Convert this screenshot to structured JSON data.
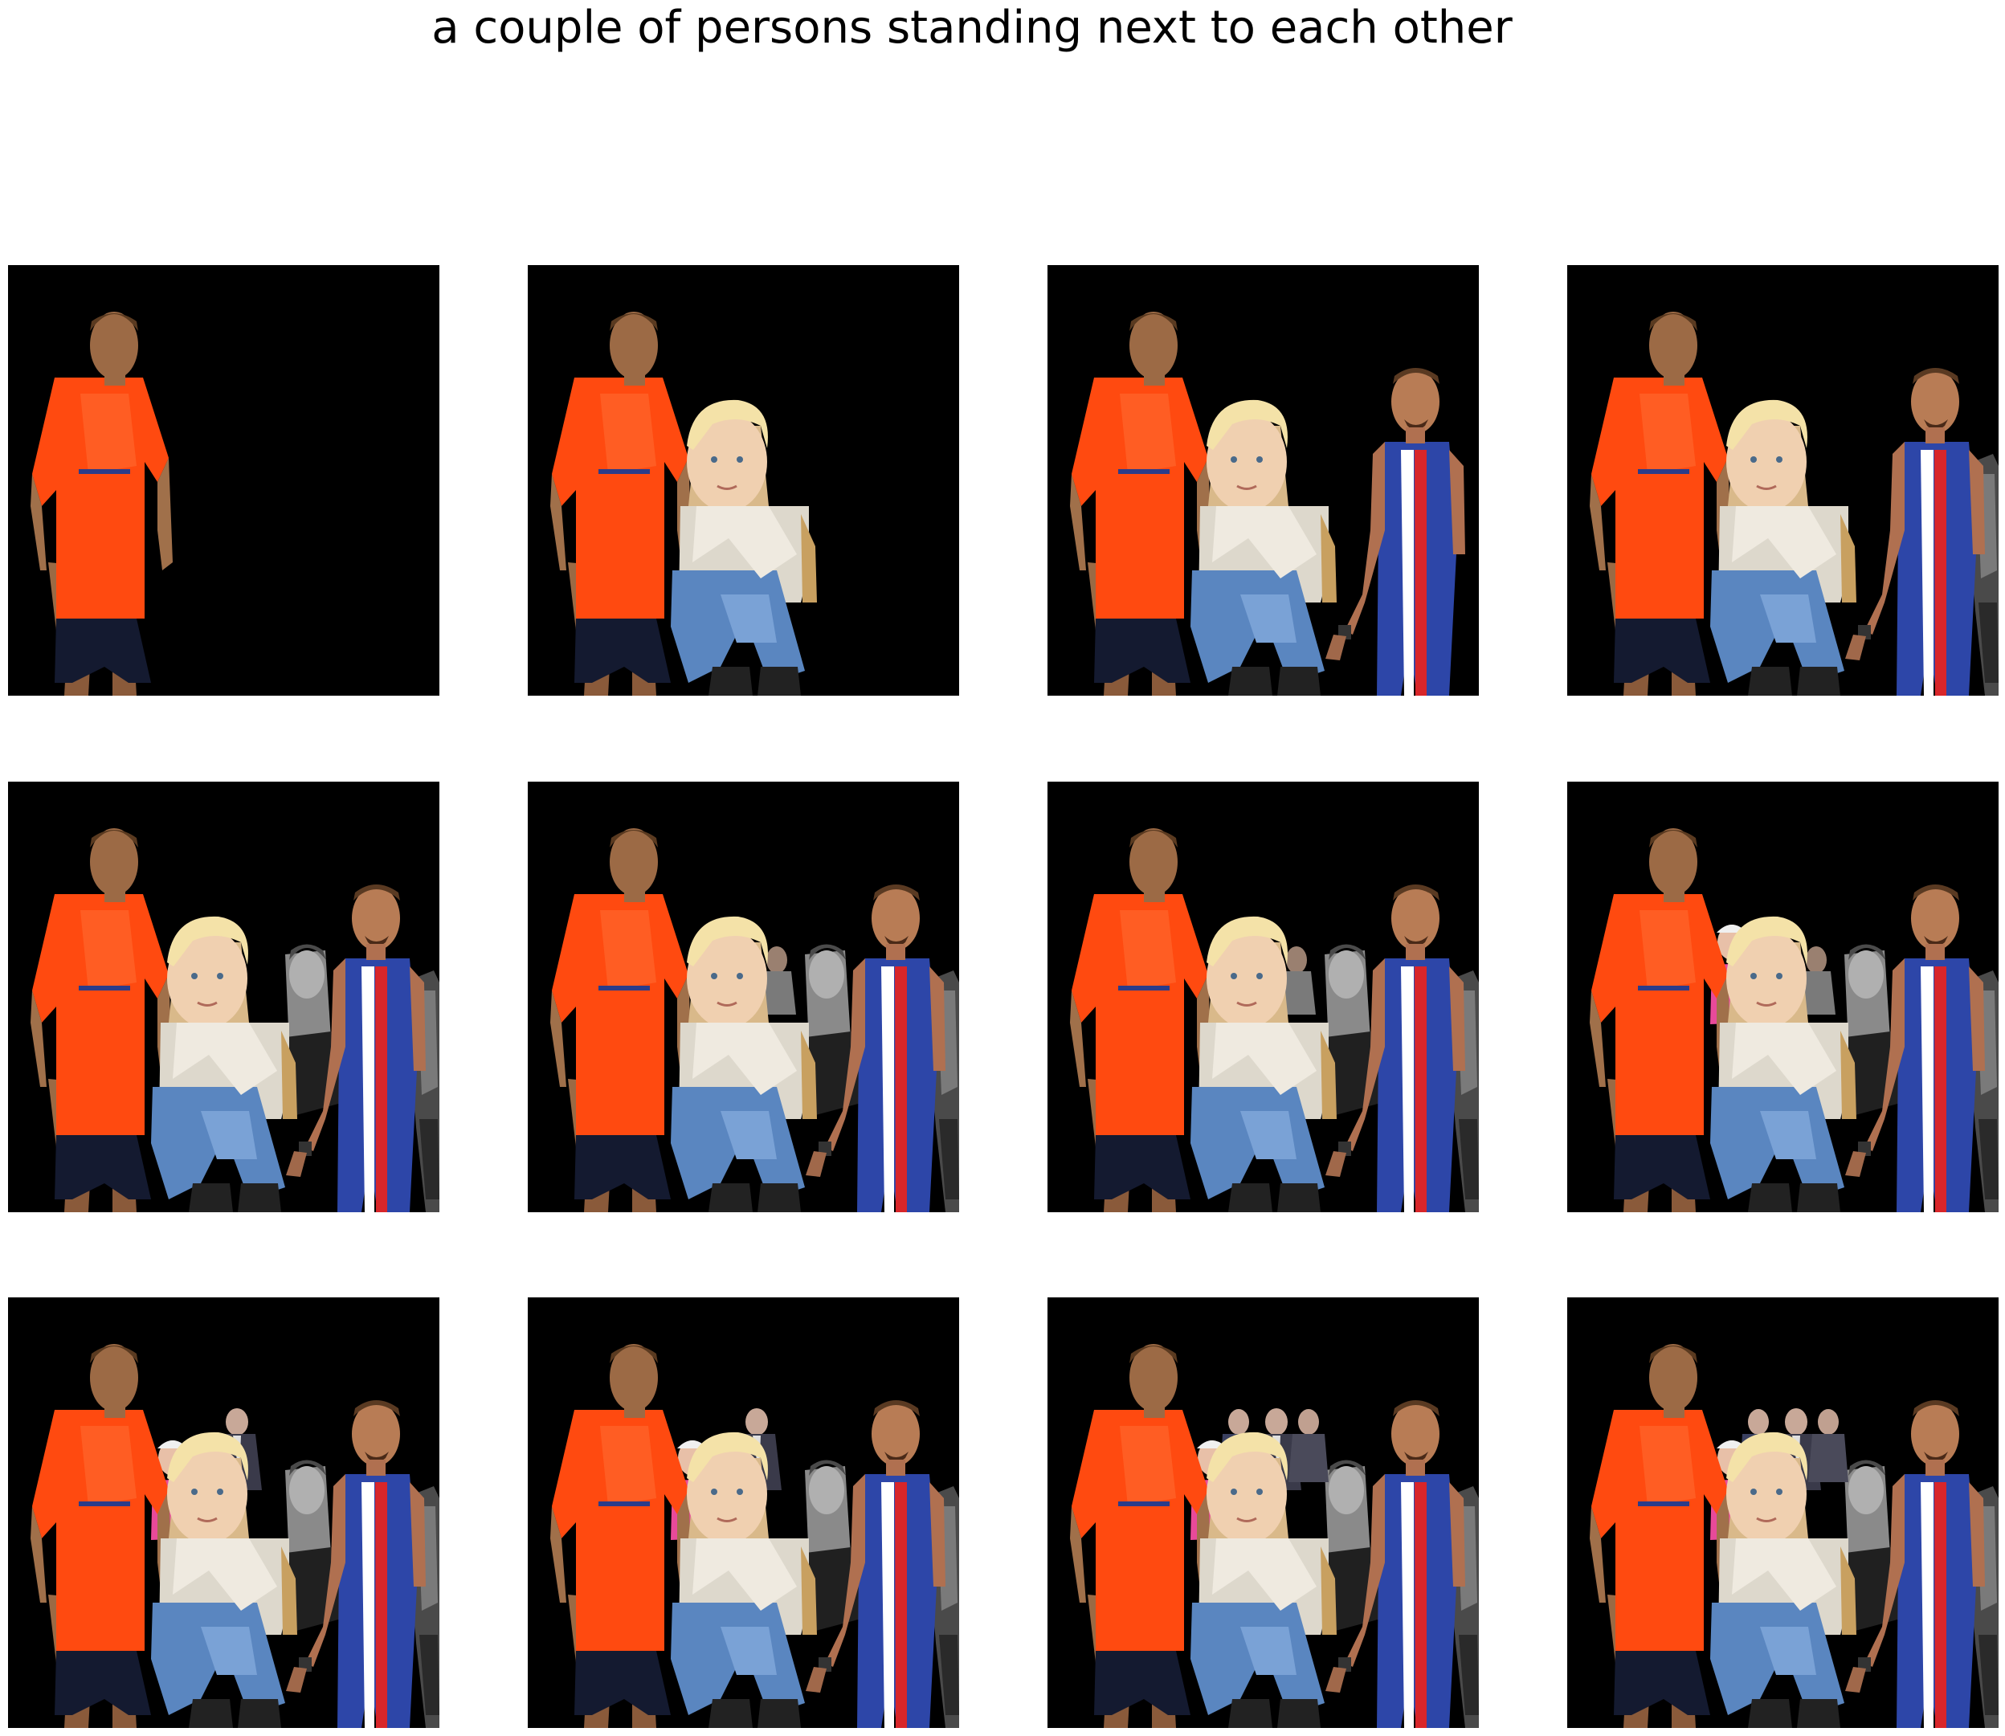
{
  "figure": {
    "title": "a couple of persons standing next to each other",
    "background_color": "#ffffff",
    "panel_background": "#000000"
  },
  "panels": [
    {
      "row": 1,
      "col": 1,
      "layers": [
        "orange-shirt-man"
      ]
    },
    {
      "row": 1,
      "col": 2,
      "layers": [
        "orange-shirt-man",
        "blond-boy"
      ]
    },
    {
      "row": 1,
      "col": 3,
      "layers": [
        "orange-shirt-man",
        "blond-boy",
        "athlete"
      ]
    },
    {
      "row": 1,
      "col": 4,
      "layers": [
        "orange-shirt-man",
        "blond-boy",
        "athlete",
        "gray-figure-right"
      ]
    },
    {
      "row": 2,
      "col": 1,
      "layers": [
        "orange-shirt-man",
        "blond-boy",
        "athlete",
        "gray-figure-right",
        "gray-woman"
      ]
    },
    {
      "row": 2,
      "col": 2,
      "layers": [
        "orange-shirt-man",
        "blond-boy",
        "athlete",
        "gray-figure-right",
        "gray-woman",
        "small-gray-person"
      ]
    },
    {
      "row": 2,
      "col": 3,
      "layers": [
        "orange-shirt-man",
        "blond-boy",
        "athlete",
        "gray-figure-right",
        "gray-woman",
        "small-gray-person"
      ]
    },
    {
      "row": 2,
      "col": 4,
      "layers": [
        "orange-shirt-man",
        "blond-boy",
        "athlete",
        "gray-figure-right",
        "gray-woman",
        "small-gray-person",
        "pink-person"
      ]
    },
    {
      "row": 3,
      "col": 1,
      "layers": [
        "orange-shirt-man",
        "blond-boy",
        "athlete",
        "gray-figure-right",
        "gray-woman",
        "pink-person",
        "suited-man"
      ]
    },
    {
      "row": 3,
      "col": 2,
      "layers": [
        "orange-shirt-man",
        "blond-boy",
        "athlete",
        "gray-figure-right",
        "gray-woman",
        "pink-person",
        "suited-man"
      ]
    },
    {
      "row": 3,
      "col": 3,
      "layers": [
        "orange-shirt-man",
        "blond-boy",
        "athlete",
        "gray-figure-right",
        "gray-woman",
        "pink-person",
        "suited-man",
        "suited-man-2"
      ]
    },
    {
      "row": 3,
      "col": 4,
      "layers": [
        "orange-shirt-man",
        "blond-boy",
        "athlete",
        "gray-figure-right",
        "gray-woman",
        "pink-person",
        "suited-man",
        "suited-man-2"
      ]
    }
  ]
}
